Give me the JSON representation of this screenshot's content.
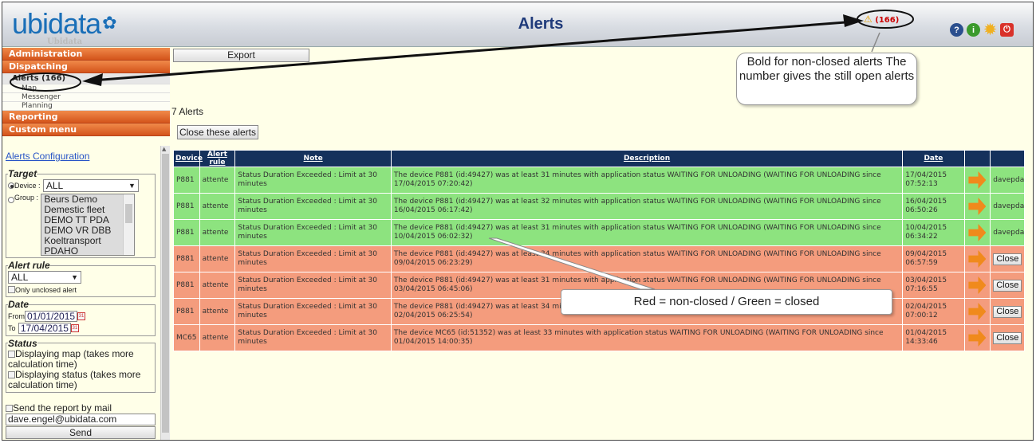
{
  "header": {
    "logo_text": "ubidata",
    "logo_sub": "Ubidata",
    "title": "Alerts",
    "alert_badge": "(166)"
  },
  "menu": {
    "administration": "Administration",
    "dispatching": "Dispatching",
    "alerts": "Alerts (166)",
    "map": "Map",
    "messenger": "Messenger",
    "planning": "Planning",
    "reporting": "Reporting",
    "custom_menu": "Custom menu"
  },
  "filters": {
    "config_link": "Alerts Configuration",
    "target_legend": "Target",
    "device_label": "Device :",
    "device_value": "ALL",
    "group_label": "Group :",
    "groups": [
      "Beurs Demo",
      "Demestic fleet",
      "DEMO TT PDA",
      "DEMO VR DBB",
      "Koeltransport",
      "PDAHO"
    ],
    "alert_rule_legend": "Alert rule",
    "alert_rule_value": "ALL",
    "only_unclosed": "Only unclosed alert",
    "date_legend": "Date",
    "from_label": "From",
    "from_value": "01/01/2015",
    "to_label": "To",
    "to_value": "17/04/2015",
    "status_legend": "Status",
    "display_map": "Displaying map (takes more calculation time)",
    "display_status": "Displaying status (takes more calculation time)",
    "send_report": "Send the report by mail",
    "email": "dave.engel@ubidata.com",
    "send_button": "Send"
  },
  "main": {
    "export_button": "Export",
    "alert_count": "7 Alerts",
    "close_button": "Close these alerts",
    "columns": [
      "Device",
      "Alert rule",
      "Note",
      "Description",
      "Date"
    ]
  },
  "rows": [
    {
      "device": "P881",
      "rule": "attente",
      "note": "Status Duration Exceeded : Limit at 30 minutes",
      "description": "The device P881 (id:49427) was at least 31 minutes with application status WAITING FOR UNLOADING (WAITING FOR UNLOADING since 17/04/2015 07:20:42)",
      "date": "17/04/2015 07:52:13",
      "closed_by": "davepda",
      "state": "closed"
    },
    {
      "device": "P881",
      "rule": "attente",
      "note": "Status Duration Exceeded : Limit at 30 minutes",
      "description": "The device P881 (id:49427) was at least 32 minutes with application status WAITING FOR UNLOADING (WAITING FOR UNLOADING since 16/04/2015 06:17:42)",
      "date": "16/04/2015 06:50:26",
      "closed_by": "davepda",
      "state": "closed"
    },
    {
      "device": "P881",
      "rule": "attente",
      "note": "Status Duration Exceeded : Limit at 30 minutes",
      "description": "The device P881 (id:49427) was at least 31 minutes with application status WAITING FOR UNLOADING (WAITING FOR UNLOADING since 10/04/2015 06:02:32)",
      "date": "10/04/2015 06:34:22",
      "closed_by": "davepda",
      "state": "closed"
    },
    {
      "device": "P881",
      "rule": "attente",
      "note": "Status Duration Exceeded : Limit at 30 minutes",
      "description": "The device P881 (id:49427) was at least 34 minutes with application status WAITING FOR UNLOADING (WAITING FOR UNLOADING since 09/04/2015 06:23:29)",
      "date": "09/04/2015 06:57:59",
      "closed_by": "Close",
      "state": "open"
    },
    {
      "device": "P881",
      "rule": "attente",
      "note": "Status Duration Exceeded : Limit at 30 minutes",
      "description": "The device P881 (id:49427) was at least 31 minutes with application status WAITING FOR UNLOADING (WAITING FOR UNLOADING since 03/04/2015 06:45:06)",
      "date": "03/04/2015 07:16:55",
      "closed_by": "Close",
      "state": "open"
    },
    {
      "device": "P881",
      "rule": "attente",
      "note": "Status Duration Exceeded : Limit at 30 minutes",
      "description": "The device P881 (id:49427) was at least 34 minutes with application status WAITING FOR UNLOADING (WAITING FOR UNLOADING since 02/04/2015 06:25:54)",
      "date": "02/04/2015 07:00:12",
      "closed_by": "Close",
      "state": "open"
    },
    {
      "device": "MC65",
      "rule": "attente",
      "note": "Status Duration Exceeded : Limit at 30 minutes",
      "description": "The device MC65 (id:51352) was at least 33 minutes with application status WAITING FOR UNLOADING (WAITING FOR UNLOADING since 01/04/2015 14:00:35)",
      "date": "01/04/2015 14:33:46",
      "closed_by": "Close",
      "state": "open"
    }
  ],
  "annotations": {
    "callout_top": "Bold for non-closed alerts The number gives the still open alerts",
    "callout_bottom": "Red = non-closed / Green = closed"
  },
  "colors": {
    "closed_row": "#8de37f",
    "open_row": "#f49c7d",
    "menu_header": "#e06a2e",
    "table_header": "#15315c",
    "title": "#1f3a7a"
  }
}
